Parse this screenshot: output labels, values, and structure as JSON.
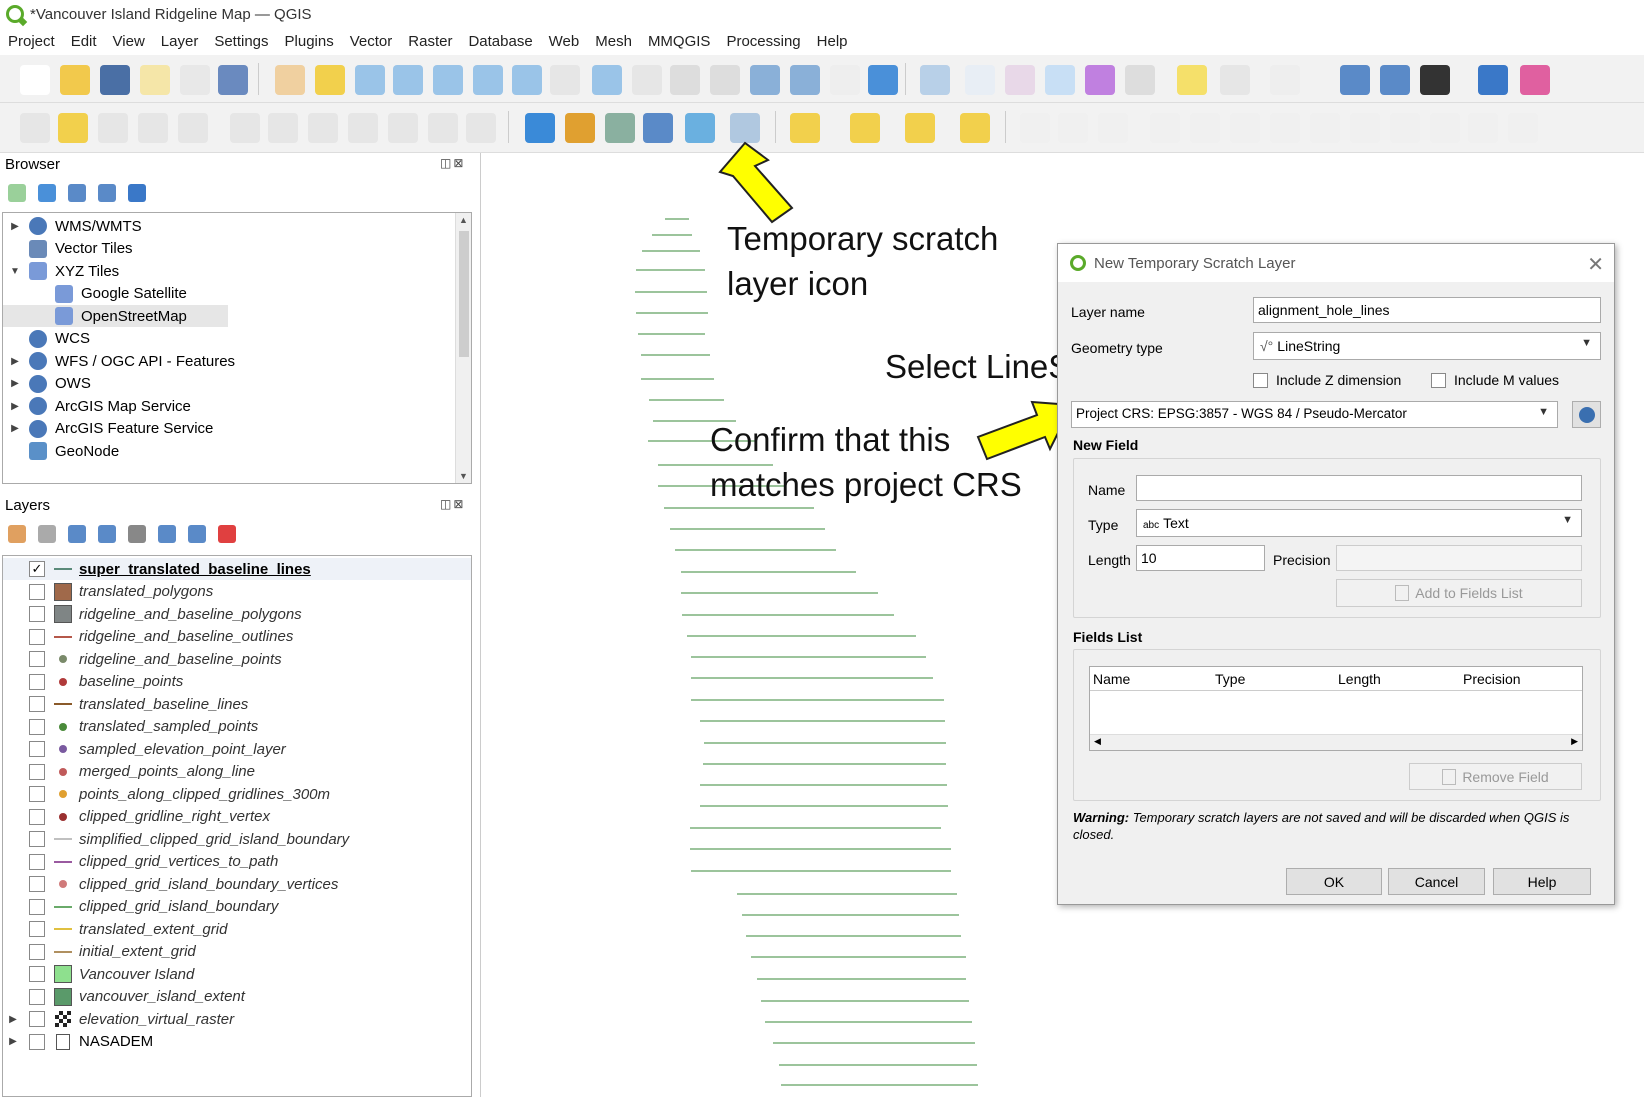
{
  "window": {
    "title": "*Vancouver Island Ridgeline Map — QGIS"
  },
  "menu": [
    "Project",
    "Edit",
    "View",
    "Layer",
    "Settings",
    "Plugins",
    "Vector",
    "Raster",
    "Database",
    "Web",
    "Mesh",
    "MMQGIS",
    "Processing",
    "Help"
  ],
  "browser": {
    "title": "Browser",
    "items": [
      {
        "label": "WMS/WMTS",
        "expand": "▶",
        "icon": "globe-icon"
      },
      {
        "label": "Vector Tiles",
        "expand": "",
        "icon": "grid-icon"
      },
      {
        "label": "XYZ Tiles",
        "expand": "▼",
        "icon": "xyz-tiles-icon"
      },
      {
        "label": "Google Satellite",
        "expand": "",
        "icon": "xyz-tiles-icon",
        "indent": true
      },
      {
        "label": "OpenStreetMap",
        "expand": "",
        "icon": "xyz-tiles-icon",
        "indent": true,
        "selected": true
      },
      {
        "label": "WCS",
        "expand": "",
        "icon": "globe-icon"
      },
      {
        "label": "WFS / OGC API - Features",
        "expand": "▶",
        "icon": "globe-icon"
      },
      {
        "label": "OWS",
        "expand": "▶",
        "icon": "globe-icon"
      },
      {
        "label": "ArcGIS Map Service",
        "expand": "▶",
        "icon": "globe-icon"
      },
      {
        "label": "ArcGIS Feature Service",
        "expand": "▶",
        "icon": "globe-icon"
      },
      {
        "label": "GeoNode",
        "expand": "",
        "icon": "geonode-icon"
      }
    ]
  },
  "layers": {
    "title": "Layers",
    "items": [
      {
        "label": "super_translated_baseline_lines",
        "checked": "✓",
        "symbol": "line",
        "color": "#5a8a7a",
        "bold": true
      },
      {
        "label": "translated_polygons",
        "checked": "",
        "symbol": "fill",
        "color": "#a0694a"
      },
      {
        "label": "ridgeline_and_baseline_polygons",
        "checked": "",
        "symbol": "fill",
        "color": "#7f8585"
      },
      {
        "label": "ridgeline_and_baseline_outlines",
        "checked": "",
        "symbol": "line",
        "color": "#b5584a"
      },
      {
        "label": "ridgeline_and_baseline_points",
        "checked": "",
        "symbol": "point",
        "color": "#7a8a6a"
      },
      {
        "label": "baseline_points",
        "checked": "",
        "symbol": "point",
        "color": "#b03a3a"
      },
      {
        "label": "translated_baseline_lines",
        "checked": "",
        "symbol": "line",
        "color": "#8a5a2a"
      },
      {
        "label": "translated_sampled_points",
        "checked": "",
        "symbol": "point",
        "color": "#4a8a3a"
      },
      {
        "label": "sampled_elevation_point_layer",
        "checked": "",
        "symbol": "point",
        "color": "#7a5aa0"
      },
      {
        "label": "merged_points_along_line",
        "checked": "",
        "symbol": "point",
        "color": "#c05a5a"
      },
      {
        "label": "points_along_clipped_gridlines_300m",
        "checked": "",
        "symbol": "point",
        "color": "#e0a030"
      },
      {
        "label": "clipped_gridline_right_vertex",
        "checked": "",
        "symbol": "point",
        "color": "#9a3030"
      },
      {
        "label": "simplified_clipped_grid_island_boundary",
        "checked": "",
        "symbol": "line",
        "color": "#c0c0c0"
      },
      {
        "label": "clipped_grid_vertices_to_path",
        "checked": "",
        "symbol": "line",
        "color": "#9a5aa0"
      },
      {
        "label": "clipped_grid_island_boundary_vertices",
        "checked": "",
        "symbol": "point",
        "color": "#d07a7a"
      },
      {
        "label": "clipped_grid_island_boundary",
        "checked": "",
        "symbol": "line",
        "color": "#6aaa6a"
      },
      {
        "label": "translated_extent_grid",
        "checked": "",
        "symbol": "line",
        "color": "#e0c040"
      },
      {
        "label": "initial_extent_grid",
        "checked": "",
        "symbol": "line",
        "color": "#b09060"
      },
      {
        "label": "Vancouver Island",
        "checked": "",
        "symbol": "fill",
        "color": "#8ee08e"
      },
      {
        "label": "vancouver_island_extent",
        "checked": "",
        "symbol": "fill",
        "color": "#5a9a6a"
      },
      {
        "label": "elevation_virtual_raster",
        "checked": "",
        "symbol": "raster",
        "color": "#333333",
        "expand": "▶"
      },
      {
        "label": "NASADEM",
        "checked": "",
        "symbol": "raster-group",
        "color": "#555555",
        "expand": "▶",
        "plain": true
      }
    ]
  },
  "annotations": {
    "scratch_icon": [
      "Temporary scratch",
      "layer icon"
    ],
    "linestring": "Select LineString",
    "crs": [
      "Confirm that this",
      "matches project CRS"
    ],
    "arrow_color": "#ffff00"
  },
  "dialog": {
    "title": "New Temporary Scratch Layer",
    "layer_name_label": "Layer name",
    "layer_name_value": "alignment_hole_lines",
    "geometry_type_label": "Geometry type",
    "geometry_type_value": "LineString",
    "include_z": "Include Z dimension",
    "include_m": "Include M values",
    "crs_value": "Project CRS: EPSG:3857 - WGS 84 / Pseudo-Mercator",
    "new_field_title": "New Field",
    "name_label": "Name",
    "name_value": "",
    "type_label": "Type",
    "type_value": "Text",
    "type_prefix": "abc",
    "length_label": "Length",
    "length_value": "10",
    "precision_label": "Precision",
    "precision_value": "",
    "add_fields_button": "Add to Fields List",
    "fields_list_title": "Fields List",
    "columns": [
      "Name",
      "Type",
      "Length",
      "Precision"
    ],
    "remove_field_button": "Remove Field",
    "warning_bold": "Warning:",
    "warning_text": " Temporary scratch layers are not saved and will be discarded when QGIS is closed.",
    "ok": "OK",
    "cancel": "Cancel",
    "help": "Help"
  },
  "colors": {
    "map_lines": "#9cc49c",
    "qgis_green": "#5aaa2a"
  }
}
